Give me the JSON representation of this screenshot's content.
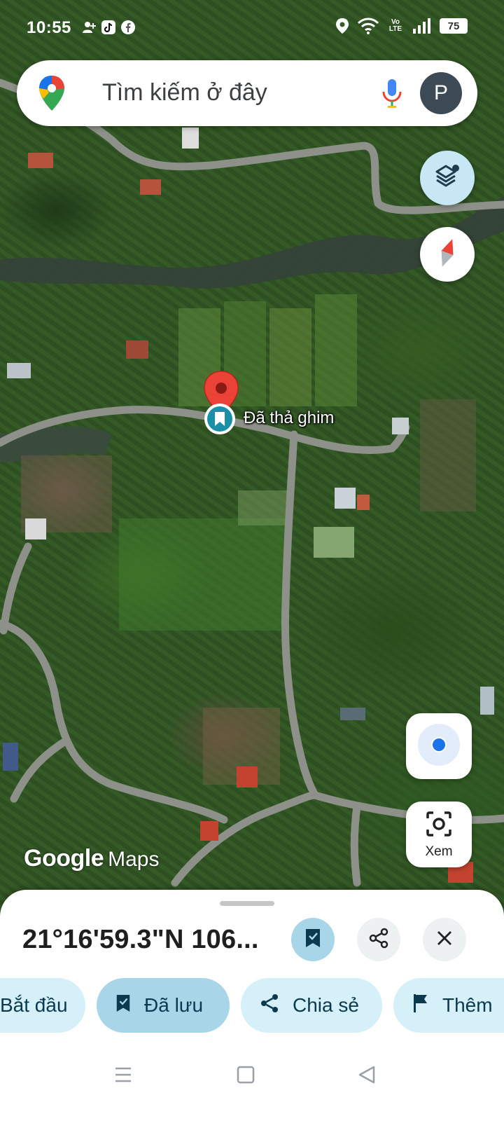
{
  "status_bar": {
    "time": "10:55",
    "battery": "75",
    "network_label": "Vo LTE",
    "icons": [
      "person-plus-icon",
      "tiktok-icon",
      "facebook-icon",
      "location-icon",
      "wifi-icon",
      "volte-icon",
      "signal-icon",
      "battery-icon"
    ]
  },
  "search": {
    "placeholder": "Tìm kiếm ở đây",
    "avatar_letter": "P"
  },
  "map": {
    "pin_label": "Đã thả ghim",
    "attribution": {
      "google": "Google",
      "maps": "Maps"
    }
  },
  "lens": {
    "label": "Xem"
  },
  "sheet": {
    "coordinates": "21°16'59.3\"N 106...",
    "chips": {
      "start": "Bắt đầu",
      "saved": "Đã lưu",
      "share": "Chia sẻ",
      "more": "Thêm"
    }
  },
  "colors": {
    "accent_saved": "#a8d5e8",
    "chip_bg": "#d5f0f9",
    "pin_red": "#ea4335",
    "avatar_bg": "#3c4a55"
  }
}
